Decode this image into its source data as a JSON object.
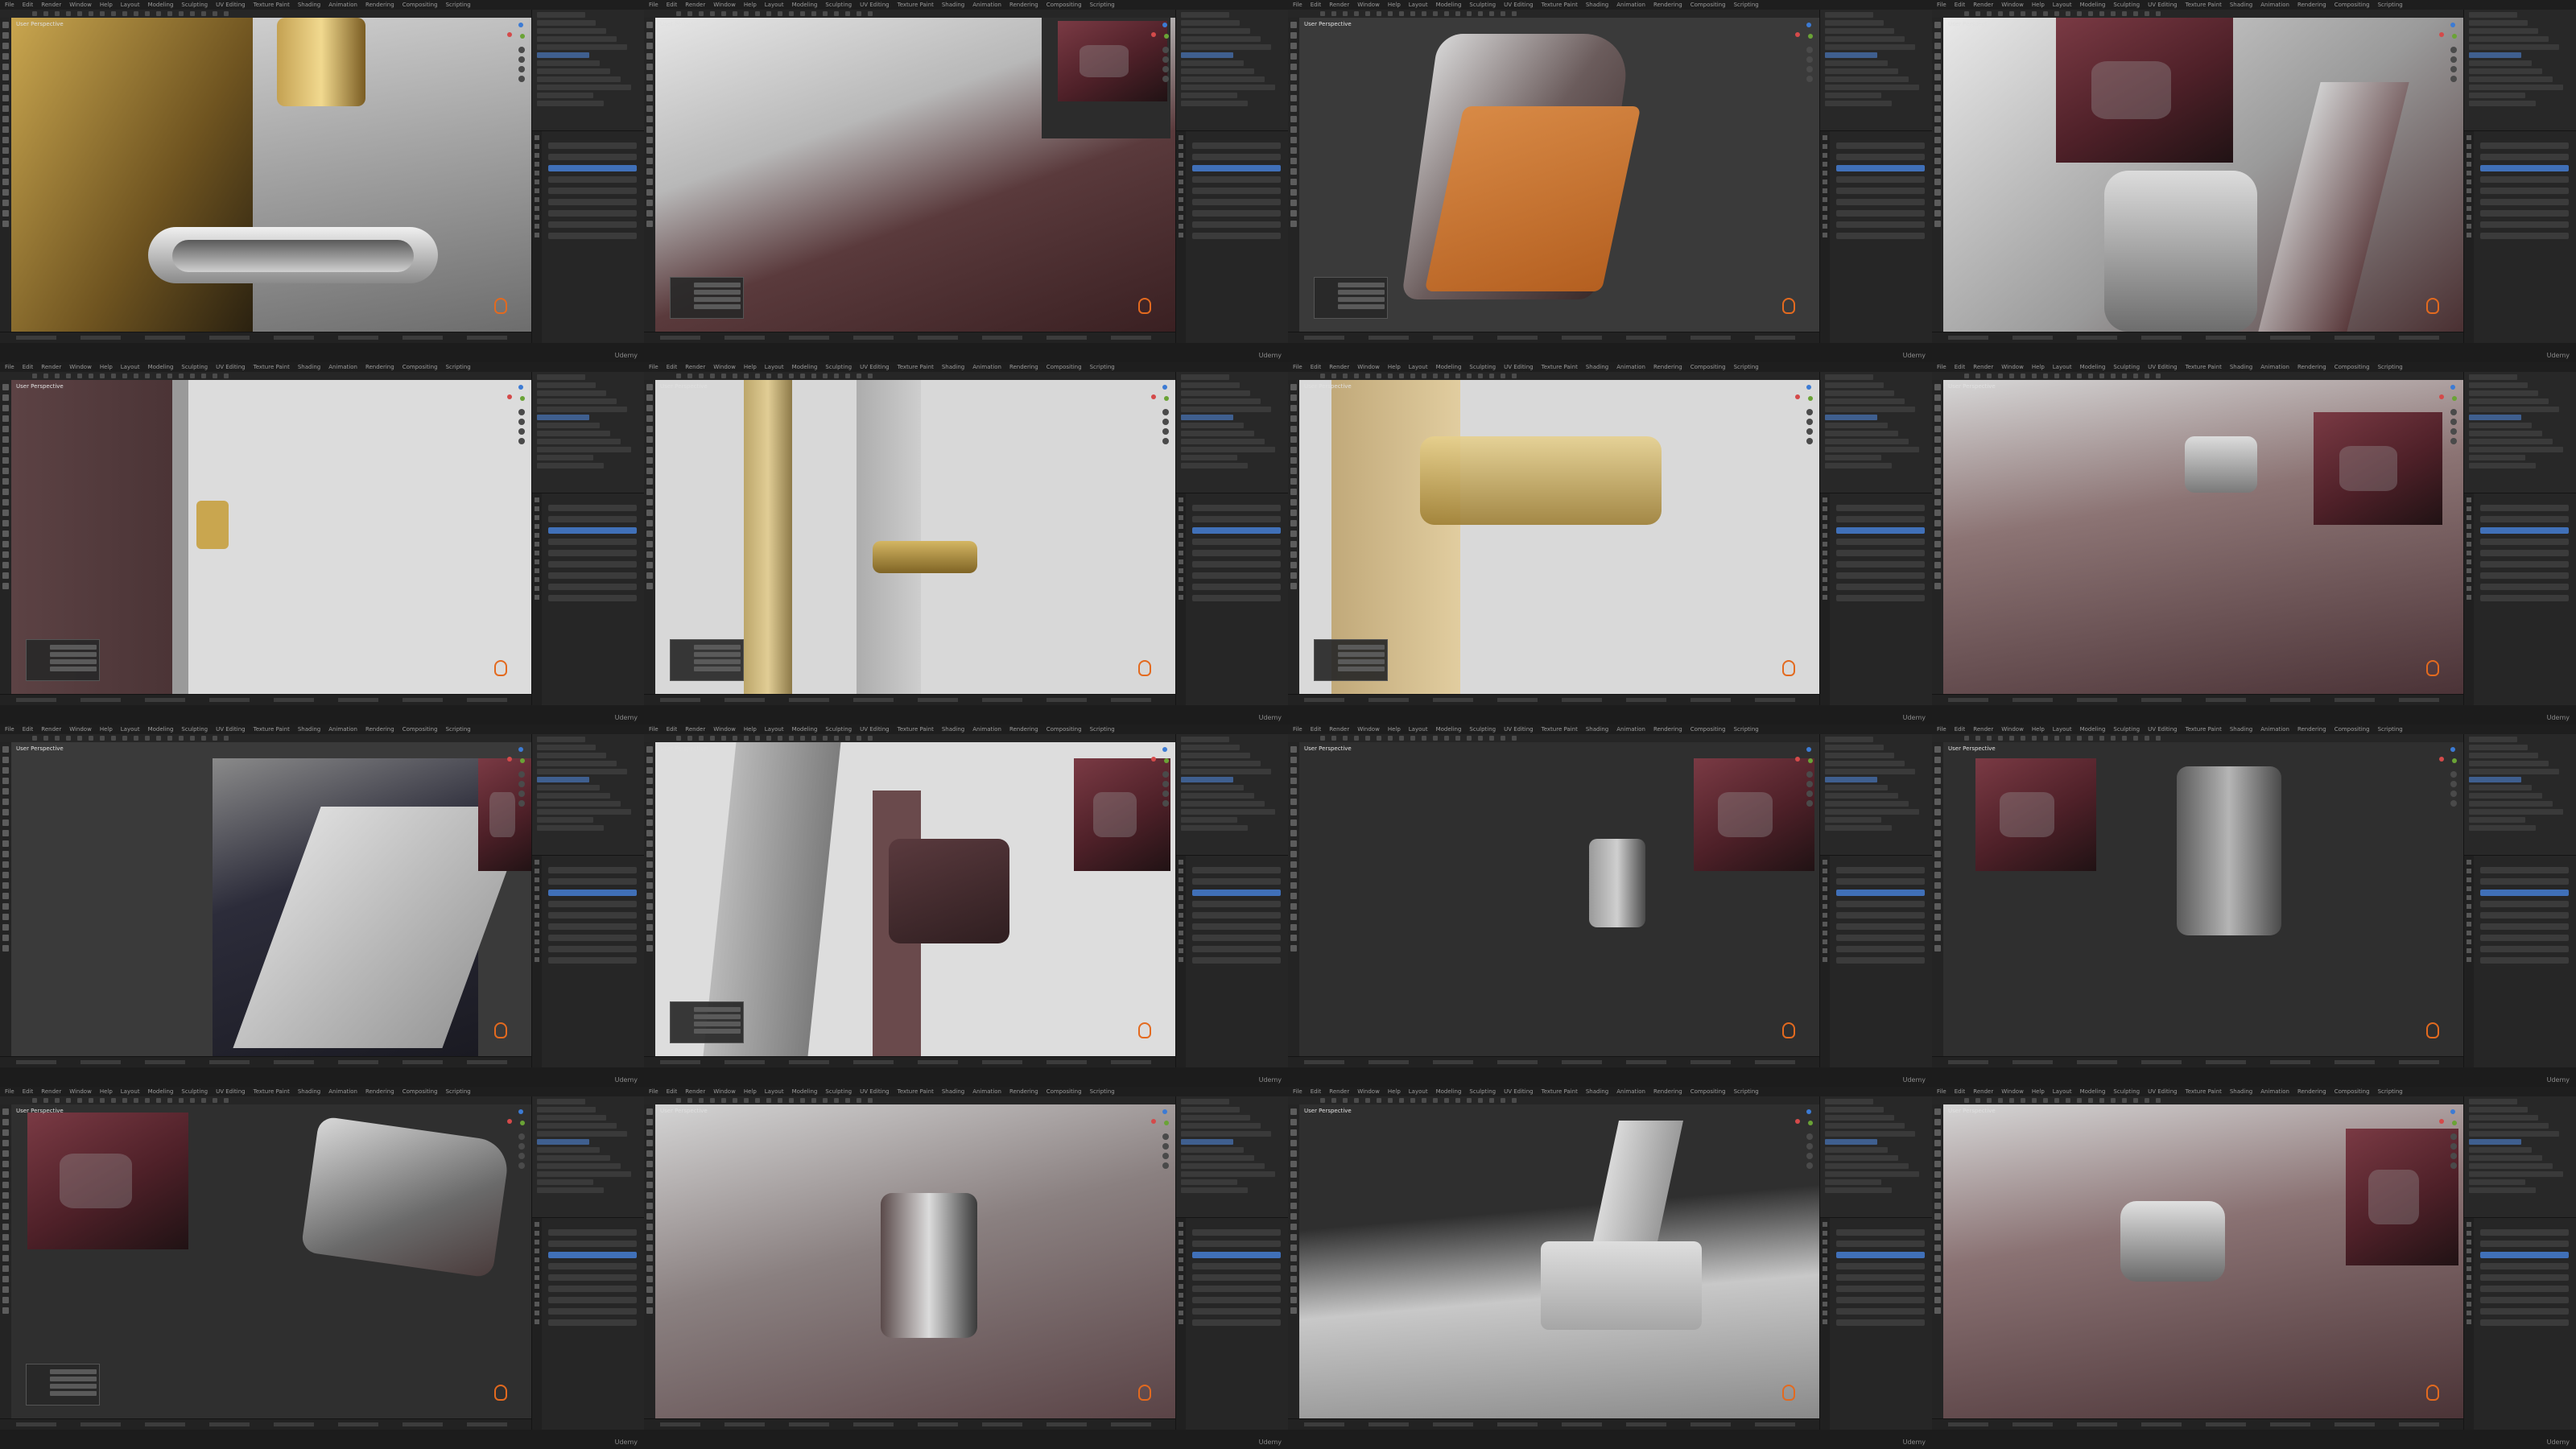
{
  "app": {
    "menu_items": [
      "File",
      "Edit",
      "Render",
      "Window",
      "Help",
      "Layout",
      "Modeling",
      "Sculpting",
      "UV Editing",
      "Texture Paint",
      "Shading",
      "Animation",
      "Rendering",
      "Compositing",
      "Scripting"
    ]
  },
  "watermark": "Udemy",
  "viewport_header": "User Perspective",
  "colors": {
    "bg_dark": "#1d1d1d",
    "panel": "#2b2b2b",
    "accent_orange": "#e36a1f",
    "selection_blue": "#3f5f8f",
    "car_burgundy": "#6a3a3e",
    "gold": "#b89a4e"
  },
  "panes": [
    {
      "theme": "gold-door-handle"
    },
    {
      "theme": "dark-door-closeup"
    },
    {
      "theme": "mirror-orange-face"
    },
    {
      "theme": "mirror-on-car-reference"
    },
    {
      "theme": "door-seam-light"
    },
    {
      "theme": "xray-handle"
    },
    {
      "theme": "gold-handle-transparent"
    },
    {
      "theme": "car-side-mirror"
    },
    {
      "theme": "photo-reference-dark"
    },
    {
      "theme": "mirror-blockout-side"
    },
    {
      "theme": "mirror-small-grey"
    },
    {
      "theme": "mirror-blockout-front"
    },
    {
      "theme": "mirror-blockout-floating"
    },
    {
      "theme": "mirror-on-door"
    },
    {
      "theme": "door-interior-grey"
    },
    {
      "theme": "car-side-final"
    }
  ]
}
